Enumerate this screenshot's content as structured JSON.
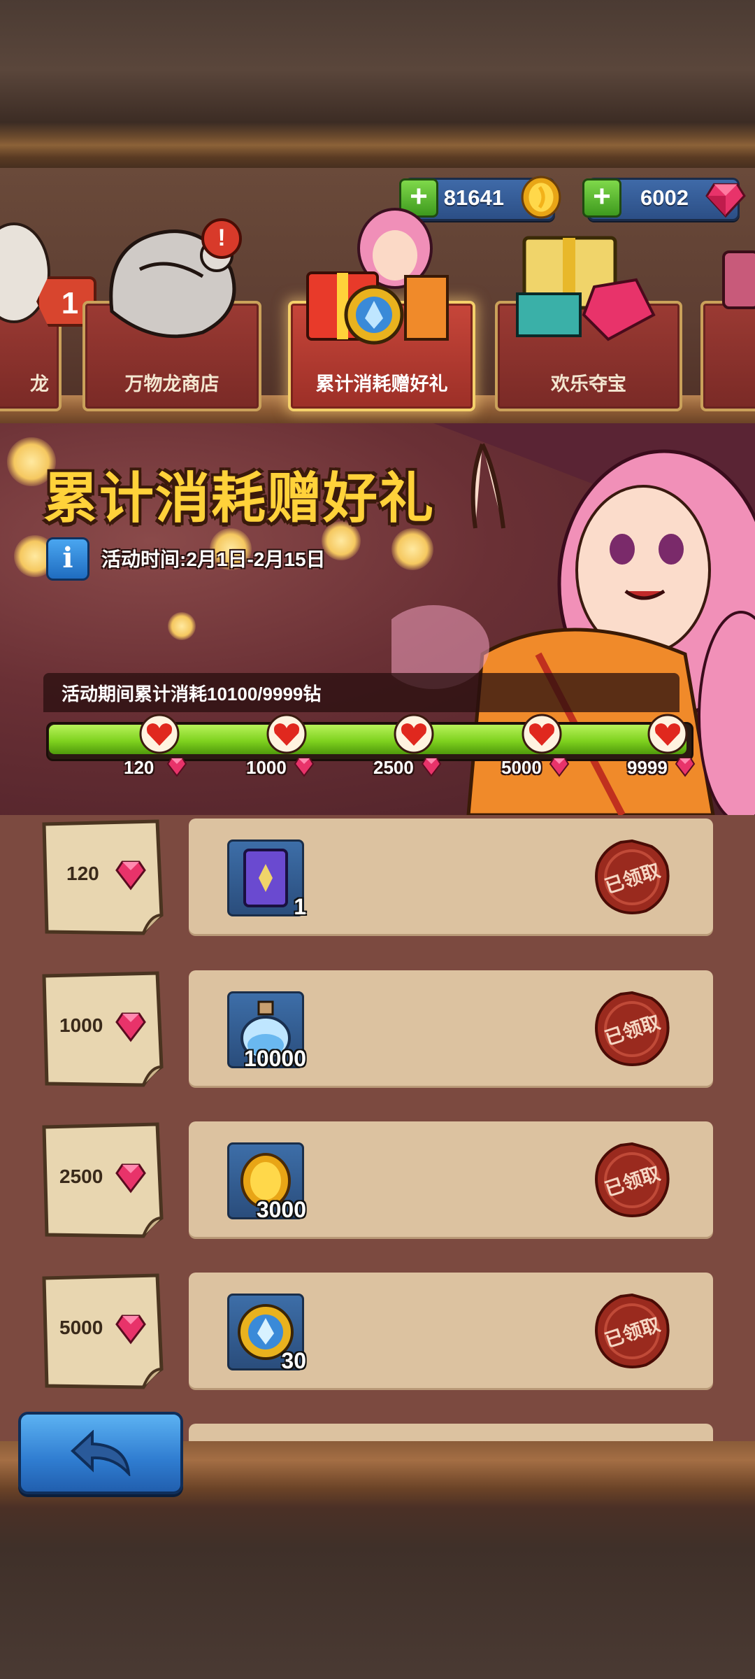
{
  "currency": {
    "coins": "81641",
    "gems": "6002",
    "coin_icon": "gold-coin-icon",
    "gem_icon": "pink-gem-icon"
  },
  "tabs": [
    {
      "label": "龙",
      "badge": "1"
    },
    {
      "label": "万物龙商店"
    },
    {
      "label": "累计消耗赠好礼",
      "active": true
    },
    {
      "label": "欢乐夺宝"
    }
  ],
  "event": {
    "title": "累计消耗赠好礼",
    "time": "活动时间:2月1日-2月15日",
    "progress_text": "活动期间累计消耗10100/9999钻",
    "progress_fraction": 1.0,
    "milestones": [
      "120",
      "1000",
      "2500",
      "5000",
      "9999"
    ]
  },
  "rewards": [
    {
      "cost": "120",
      "item_icon": "ticket-card-icon",
      "count": "1",
      "status": "已领取"
    },
    {
      "cost": "1000",
      "item_icon": "potion-bottle-icon",
      "count": "10000",
      "status": "已领取"
    },
    {
      "cost": "2500",
      "item_icon": "gold-coin-icon",
      "count": "3000",
      "status": "已领取"
    },
    {
      "cost": "5000",
      "item_icon": "crystal-medal-icon",
      "count": "30",
      "status": "已领取"
    }
  ],
  "colors": {
    "accent": "#ffd23a",
    "progress": "#7fd21f",
    "row": "#dcc2a0",
    "seal": "#9a2a1e"
  }
}
